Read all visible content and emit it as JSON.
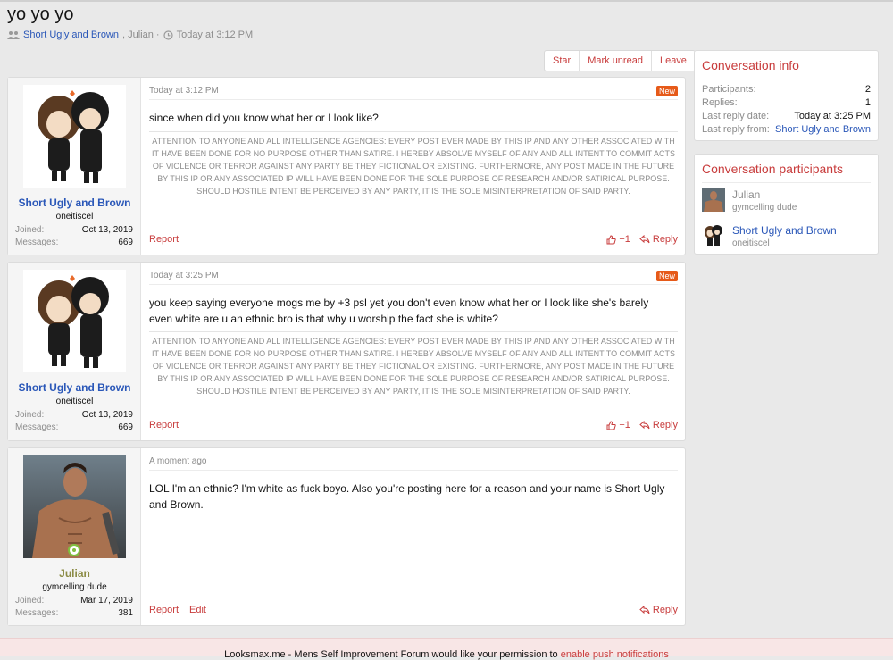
{
  "conversation": {
    "title": "yo yo yo",
    "participants_link": "Short Ugly and Brown",
    "participants_rest": ", Julian ·",
    "time": "Today at 3:12 PM"
  },
  "actions": {
    "star": "Star",
    "mark_unread": "Mark unread",
    "leave": "Leave"
  },
  "signature": "ATTENTION TO ANYONE AND ALL INTELLIGENCE AGENCIES: EVERY POST EVER MADE BY THIS IP AND ANY OTHER ASSOCIATED WITH IT HAVE BEEN DONE FOR NO PURPOSE OTHER THAN SATIRE. I HEREBY ABSOLVE MYSELF OF ANY AND ALL INTENT TO COMMIT ACTS OF VIOLENCE OR TERROR AGAINST ANY PARTY BE THEY FICTIONAL OR EXISTING. FURTHERMORE, ANY POST MADE IN THE FUTURE BY THIS IP OR ANY ASSOCIATED IP WILL HAVE BEEN DONE FOR THE SOLE PURPOSE OF RESEARCH AND/OR SATIRICAL PURPOSE. SHOULD HOSTILE INTENT BE PERCEIVED BY ANY PARTY, IT IS THE SOLE MISINTERPRETATION OF SAID PARTY.",
  "messages": [
    {
      "user": "Short Ugly and Brown",
      "user_title": "oneitiscel",
      "joined_label": "Joined:",
      "joined": "Oct 13, 2019",
      "messages_label": "Messages:",
      "message_count": "669",
      "date": "Today at 3:12 PM",
      "badge": "New",
      "text": "since when did you know what her or I look like?",
      "report": "Report",
      "reactions": "+1",
      "reply": "Reply"
    },
    {
      "user": "Short Ugly and Brown",
      "user_title": "oneitiscel",
      "joined_label": "Joined:",
      "joined": "Oct 13, 2019",
      "messages_label": "Messages:",
      "message_count": "669",
      "date": "Today at 3:25 PM",
      "badge": "New",
      "text": "you keep saying everyone mogs me by +3 psl yet you don't even know what her or I look like she's barely even white are u an ethnic bro is that why u worship the fact she is white?",
      "report": "Report",
      "reactions": "+1",
      "reply": "Reply"
    },
    {
      "user": "Julian",
      "user_title": "gymcelling dude",
      "joined_label": "Joined:",
      "joined": "Mar 17, 2019",
      "messages_label": "Messages:",
      "message_count": "381",
      "date": "A moment ago",
      "text": "LOL I'm an ethnic? I'm white as fuck boyo. Also you're posting here for a reason and your name is Short Ugly and Brown.",
      "report": "Report",
      "edit": "Edit",
      "reply": "Reply"
    }
  ],
  "info_card": {
    "title": "Conversation info",
    "rows": [
      {
        "label": "Participants:",
        "value": "2"
      },
      {
        "label": "Replies:",
        "value": "1"
      },
      {
        "label": "Last reply date:",
        "value": "Today at 3:25 PM"
      },
      {
        "label": "Last reply from:",
        "value": "Short Ugly and Brown"
      }
    ]
  },
  "participants_card": {
    "title": "Conversation participants",
    "people": [
      {
        "name": "Julian",
        "title": "gymcelling dude"
      },
      {
        "name": "Short Ugly and Brown",
        "title": "oneitiscel"
      }
    ]
  },
  "notice": {
    "text": "Looksmax.me - Mens Self Improvement Forum would like your permission to",
    "link": "enable push notifications"
  },
  "colors": {
    "accent": "#c83c3c",
    "link": "#2a57b8",
    "badge": "#e65a19",
    "online": "#7fbf3f"
  }
}
